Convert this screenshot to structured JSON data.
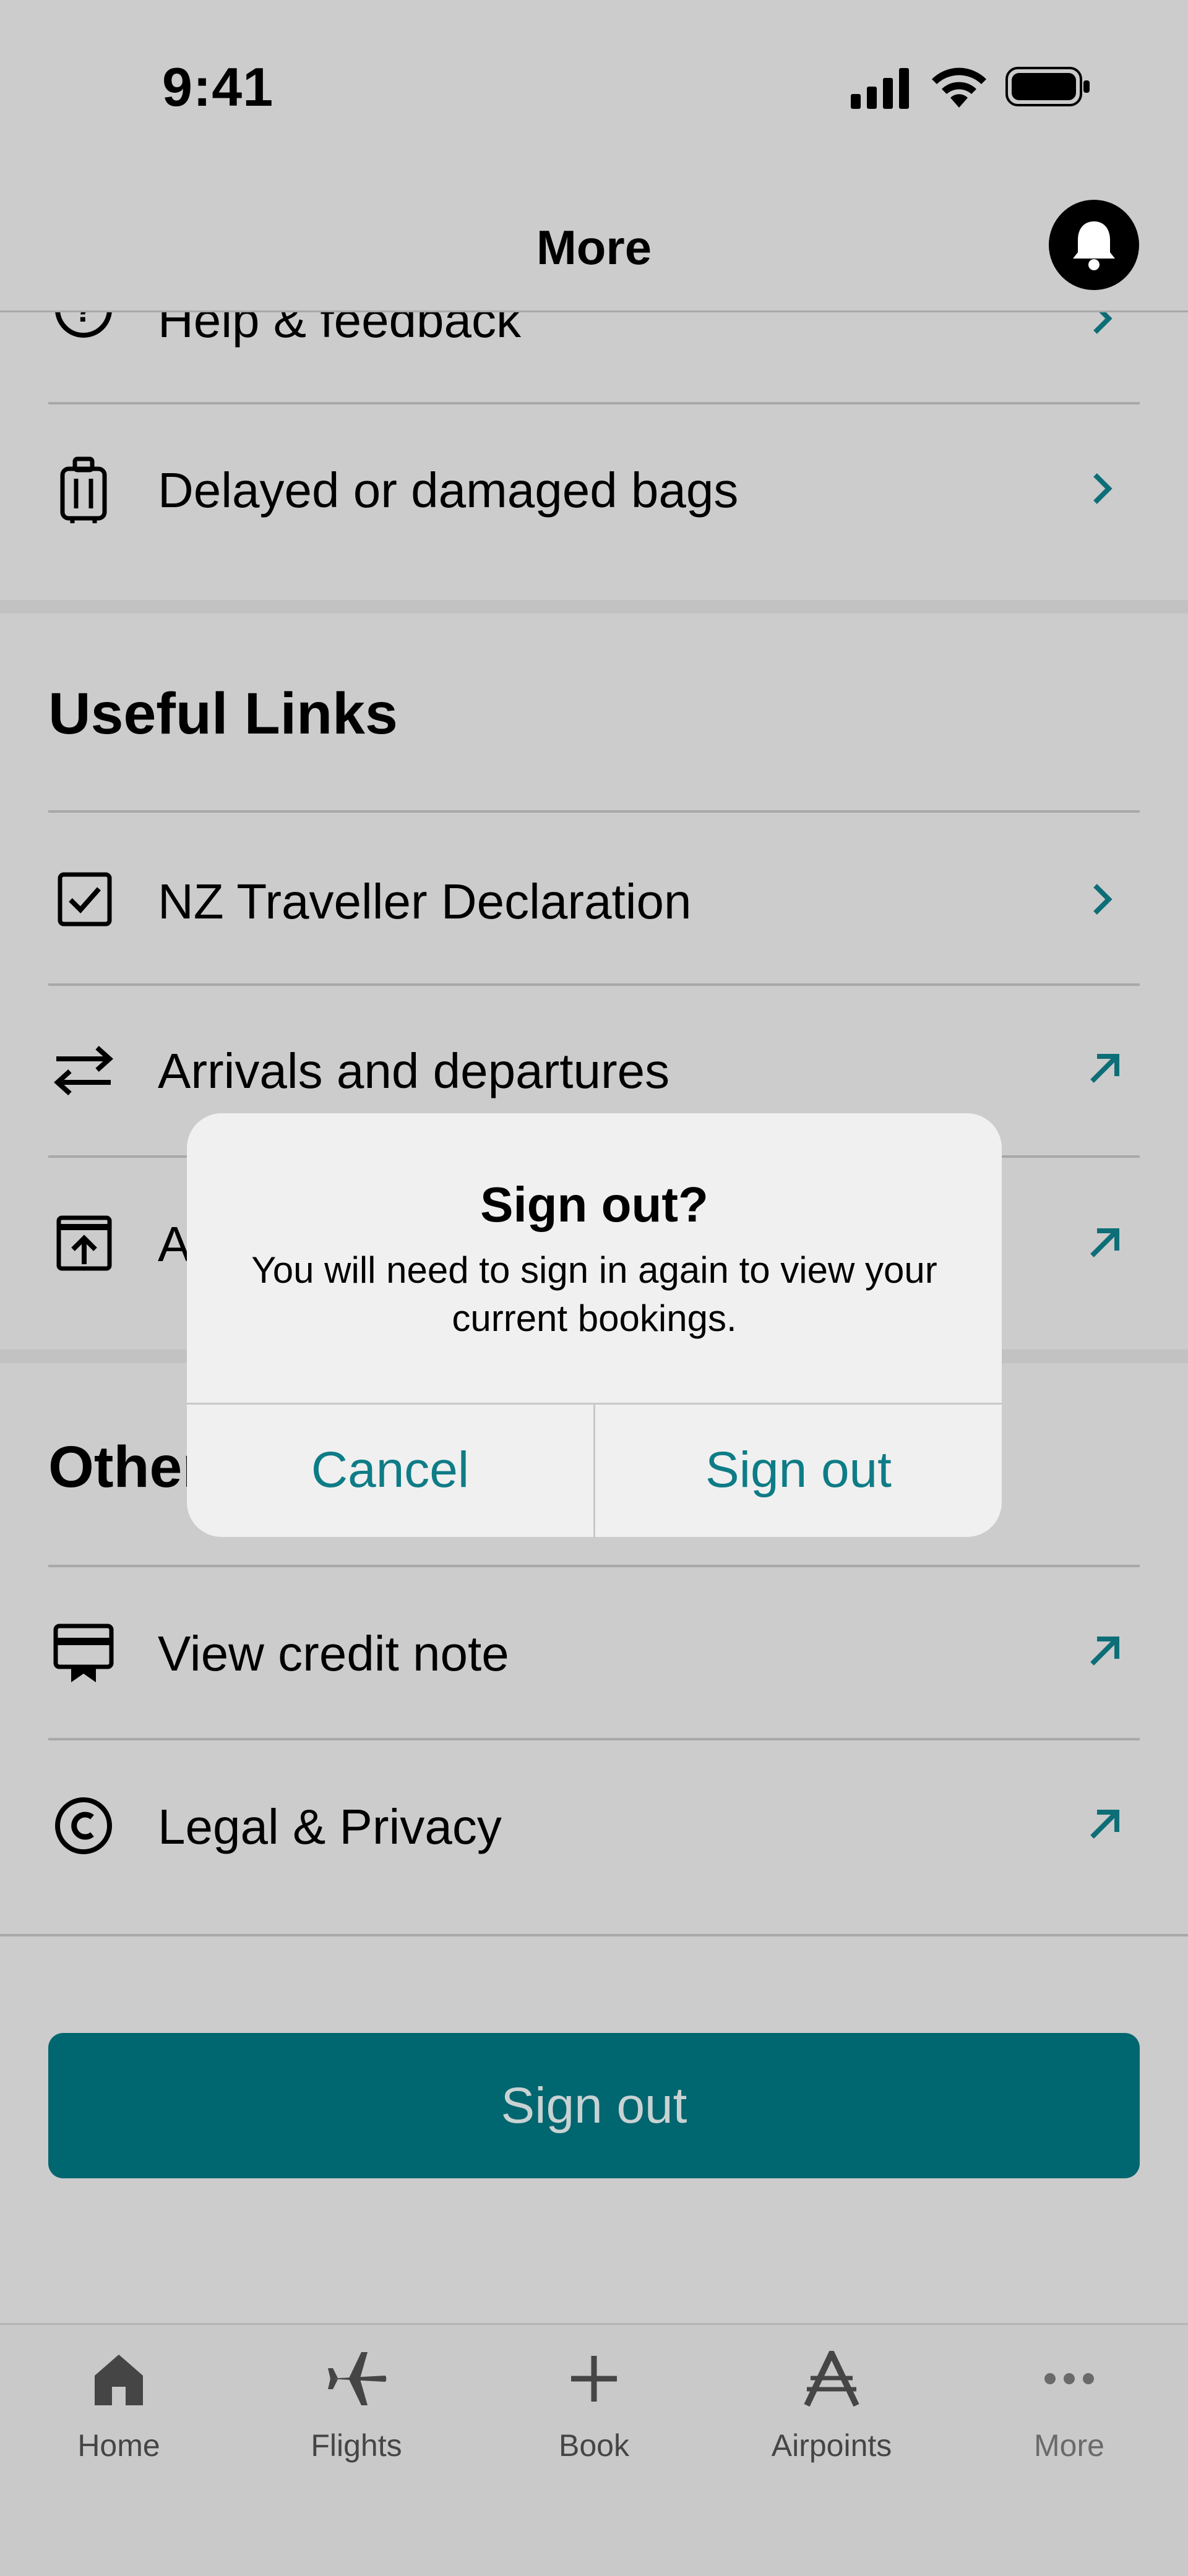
{
  "status_bar": {
    "time": "9:41"
  },
  "header": {
    "title": "More"
  },
  "support_rows": [
    {
      "label": "Help & feedback",
      "icon": "help-circle-icon",
      "trailing": "chevron"
    },
    {
      "label": "Delayed or damaged bags",
      "icon": "luggage-icon",
      "trailing": "chevron"
    }
  ],
  "useful_links": {
    "heading": "Useful Links",
    "items": [
      {
        "label": "NZ Traveller Declaration",
        "icon": "checkbox-icon",
        "trailing": "chevron"
      },
      {
        "label": "Arrivals and departures",
        "icon": "arrows-swap-icon",
        "trailing": "external"
      },
      {
        "label": "A",
        "icon": "upload-box-icon",
        "trailing": "external"
      }
    ]
  },
  "other": {
    "heading": "Other",
    "items": [
      {
        "label": "View credit note",
        "icon": "credit-note-icon",
        "trailing": "external"
      },
      {
        "label": "Legal & Privacy",
        "icon": "copyright-icon",
        "trailing": "external"
      }
    ]
  },
  "sign_out_button": {
    "label": "Sign out"
  },
  "dialog": {
    "title": "Sign out?",
    "message": "You will need to sign in again to view your current bookings.",
    "cancel_label": "Cancel",
    "confirm_label": "Sign out"
  },
  "tabs": [
    {
      "label": "Home",
      "icon": "home-icon"
    },
    {
      "label": "Flights",
      "icon": "plane-icon"
    },
    {
      "label": "Book",
      "icon": "plus-icon"
    },
    {
      "label": "Airpoints",
      "icon": "airpoints-icon"
    },
    {
      "label": "More",
      "icon": "more-dots-icon",
      "active": true
    }
  ],
  "colors": {
    "accent": "#00666f",
    "accent_text": "#0e7c86",
    "dim_bg": "#cccccc"
  }
}
